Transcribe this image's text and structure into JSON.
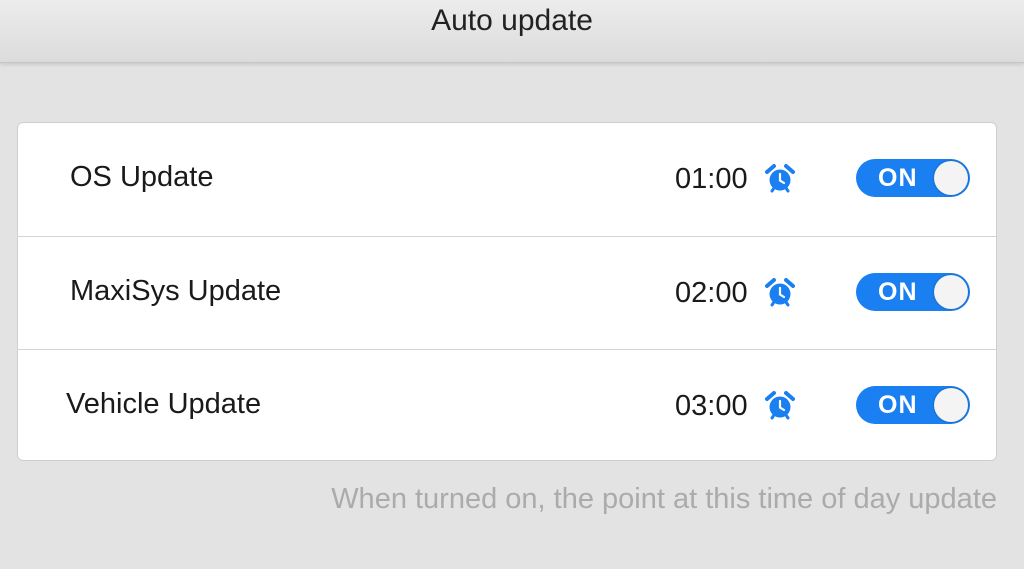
{
  "header": {
    "title": "Auto update"
  },
  "settings": {
    "rows": [
      {
        "label": "OS Update",
        "time": "01:00",
        "icon": "alarm-clock-icon",
        "toggle": "ON"
      },
      {
        "label": "MaxiSys Update",
        "time": "02:00",
        "icon": "alarm-clock-icon",
        "toggle": "ON"
      },
      {
        "label": "Vehicle Update",
        "time": "03:00",
        "icon": "alarm-clock-icon",
        "toggle": "ON"
      }
    ]
  },
  "footnote": "When turned on, the point at this time of day update",
  "colors": {
    "accent": "#1a7ff0",
    "background": "#e3e3e3",
    "card": "#ffffff",
    "footnote": "#ababab"
  }
}
